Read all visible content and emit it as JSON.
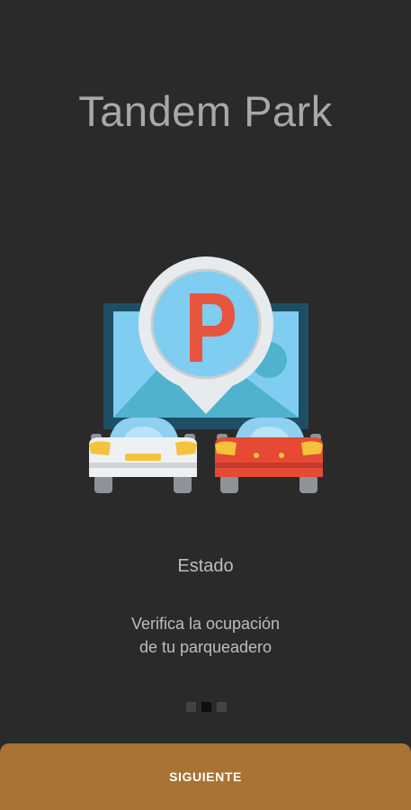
{
  "app": {
    "title": "Tandem Park"
  },
  "slide": {
    "illustration_icon": "parking-lot-illustration",
    "heading": "Estado",
    "description": "Verifica la ocupación\nde tu parqueadero"
  },
  "pager": {
    "total_pages": 3,
    "current_page": 2
  },
  "actions": {
    "next_label": "SIGUIENTE"
  },
  "colors": {
    "background": "#2a2a2a",
    "button": "#a87333",
    "title_text": "#a8a8a8"
  }
}
